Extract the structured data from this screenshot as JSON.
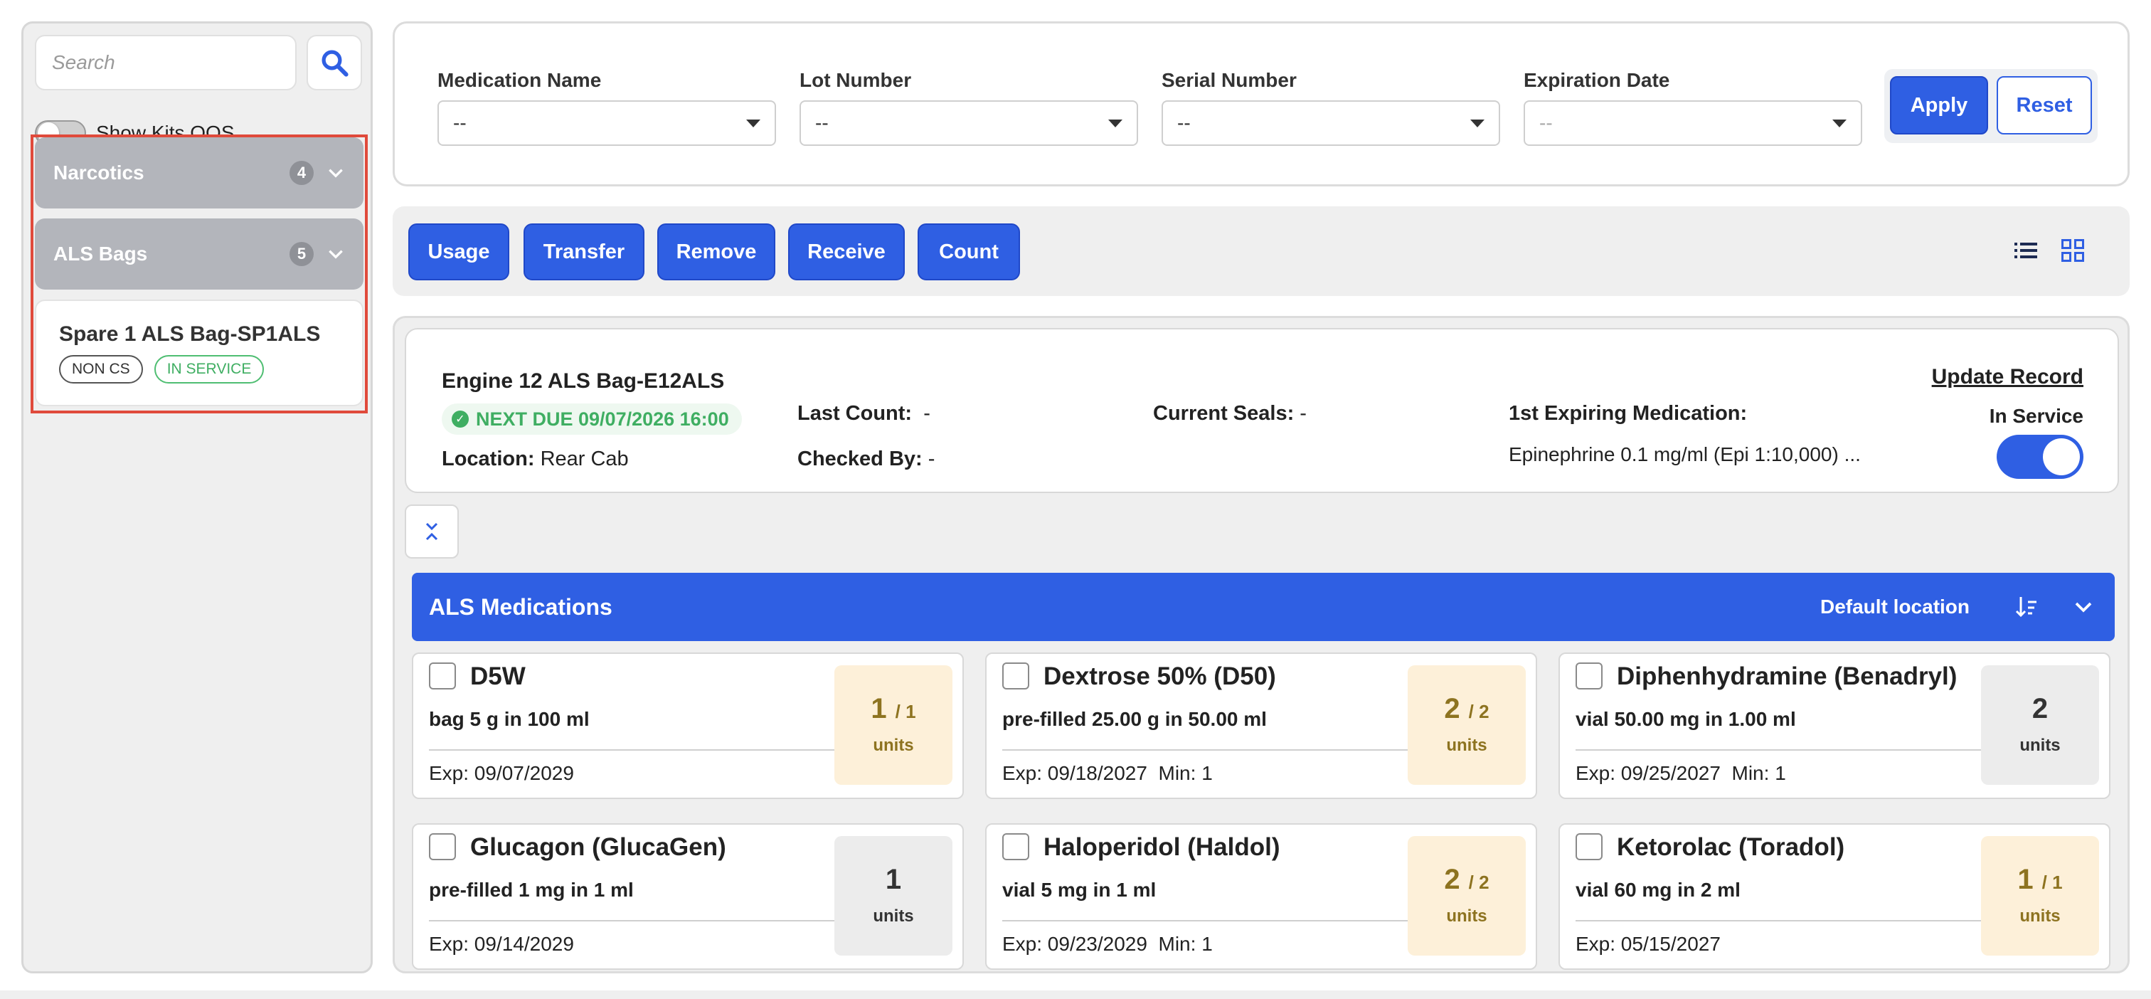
{
  "sidebar": {
    "search_placeholder": "Search",
    "show_kits_oos_label": "Show Kits OOS",
    "show_kits_oos_enabled": false,
    "groups": [
      {
        "label": "Narcotics",
        "count": "4",
        "expanded": false
      },
      {
        "label": "ALS Bags",
        "count": "5",
        "expanded": false
      }
    ],
    "kit_card": {
      "title": "Spare 1 ALS Bag-SP1ALS",
      "badges": [
        "NON CS",
        "IN SERVICE"
      ]
    }
  },
  "filters": {
    "medication_name": {
      "label": "Medication Name",
      "value": "--"
    },
    "lot_number": {
      "label": "Lot Number",
      "value": "--"
    },
    "serial_number": {
      "label": "Serial Number",
      "value": "--"
    },
    "expiration_date": {
      "label": "Expiration Date",
      "value": "--"
    },
    "apply_label": "Apply",
    "reset_label": "Reset"
  },
  "actions": {
    "usage": "Usage",
    "transfer": "Transfer",
    "remove": "Remove",
    "receive": "Receive",
    "count": "Count",
    "view_icons": [
      "list-view-icon",
      "grid-view-icon"
    ]
  },
  "kit_info": {
    "title": "Engine 12 ALS Bag-E12ALS",
    "next_due": "NEXT DUE 09/07/2026 16:00",
    "location_label": "Location:",
    "location_value": "Rear Cab",
    "last_count_label": "Last Count:",
    "last_count_value": "-",
    "checked_by_label": "Checked By:",
    "checked_by_value": "-",
    "current_seals_label": "Current Seals:",
    "current_seals_value": "-",
    "first_expiring_label": "1st Expiring Medication:",
    "first_expiring_value": "Epinephrine 0.1 mg/ml (Epi 1:10,000) ...",
    "update_record": "Update Record",
    "in_service_label": "In Service",
    "in_service": true
  },
  "section": {
    "title": "ALS Medications",
    "location": "Default location"
  },
  "colors": {
    "primary": "#2f5fe3",
    "success": "#3fae62",
    "warning_bg": "#fdf0d9",
    "warning_text": "#8d7320",
    "highlight": "#e04a3b"
  },
  "medications": [
    {
      "name": "D5W",
      "detail": "bag 5 g in 100 ml",
      "exp": "Exp: 09/07/2029",
      "min": "",
      "qty": "1",
      "of": "/ 1",
      "unit": "units",
      "status": "partial"
    },
    {
      "name": "Dextrose 50% (D50)",
      "detail": "pre-filled 25.00 g in 50.00 ml",
      "exp": "Exp: 09/18/2027",
      "min": "Min: 1",
      "qty": "2",
      "of": "/ 2",
      "unit": "units",
      "status": "partial"
    },
    {
      "name": "Diphenhydramine (Benadryl)",
      "detail": "vial 50.00 mg in 1.00 ml",
      "exp": "Exp: 09/25/2027",
      "min": "Min: 1",
      "qty": "2",
      "of": "",
      "unit": "units",
      "status": "gray"
    },
    {
      "name": "Glucagon (GlucaGen)",
      "detail": "pre-filled 1 mg in 1 ml",
      "exp": "Exp: 09/14/2029",
      "min": "",
      "qty": "1",
      "of": "",
      "unit": "units",
      "status": "gray"
    },
    {
      "name": "Haloperidol (Haldol)",
      "detail": "vial 5 mg in 1 ml",
      "exp": "Exp: 09/23/2029",
      "min": "Min: 1",
      "qty": "2",
      "of": "/ 2",
      "unit": "units",
      "status": "partial"
    },
    {
      "name": "Ketorolac (Toradol)",
      "detail": "vial 60 mg in 2 ml",
      "exp": "Exp: 05/15/2027",
      "min": "",
      "qty": "1",
      "of": "/ 1",
      "unit": "units",
      "status": "partial"
    }
  ]
}
